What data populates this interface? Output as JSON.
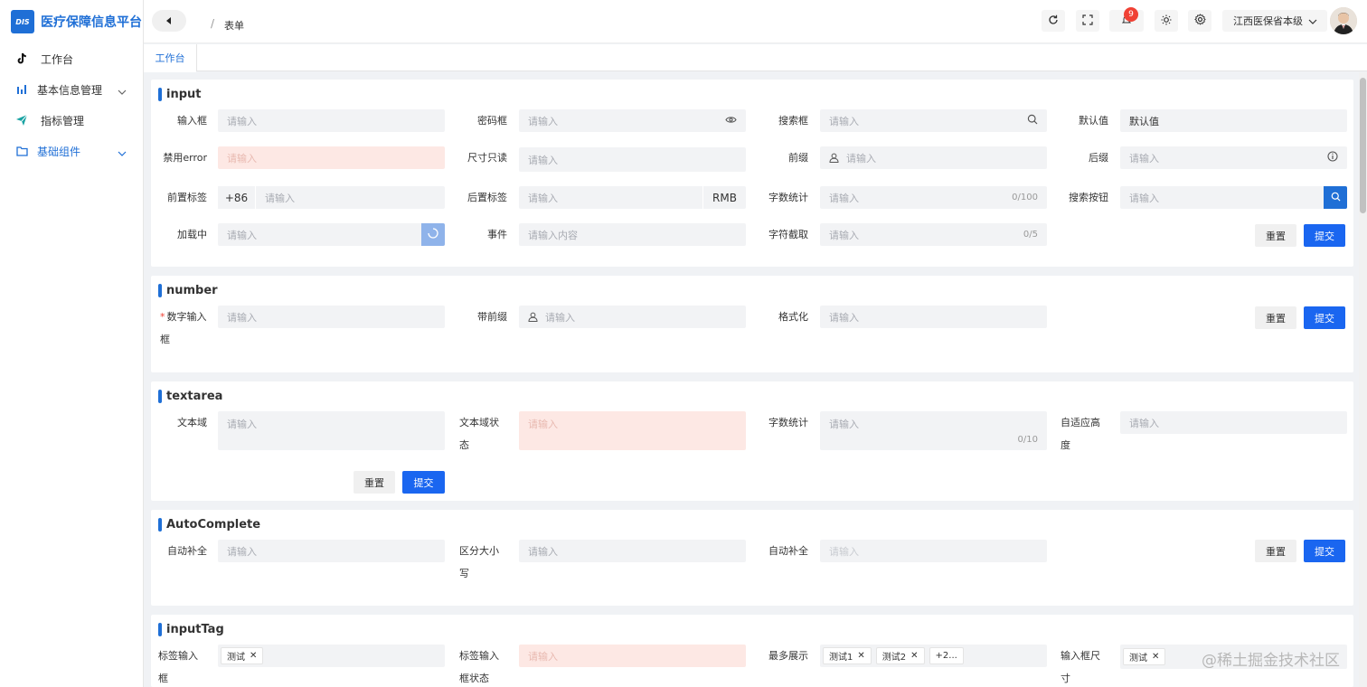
{
  "app": {
    "logo_mark": "DIS",
    "title": "医疗保障信息平台"
  },
  "sidebar": {
    "items": [
      {
        "label": "工作台",
        "icon": "tiktok-icon"
      },
      {
        "label": "基本信息管理",
        "icon": "bar-chart-icon"
      },
      {
        "label": "指标管理",
        "icon": "paper-plane-icon"
      },
      {
        "label": "基础组件",
        "icon": "folder-icon"
      }
    ]
  },
  "header": {
    "breadcrumb_sep": "/",
    "breadcrumb": "表单",
    "notification_count": "9",
    "org": "江西医保省本级"
  },
  "tabs": [
    {
      "label": "工作台"
    }
  ],
  "cards": {
    "input": {
      "title": "input",
      "labels": [
        "输入框",
        "密码框",
        "搜索框",
        "默认值",
        "禁用error",
        "尺寸只读",
        "前缀",
        "后缀",
        "前置标签",
        "后置标签",
        "字数统计",
        "搜索按钮",
        "加载中",
        "事件",
        "字符截取"
      ],
      "placeholder": "请输入",
      "event_placeholder": "请输入内容",
      "default_value": "默认值",
      "prepend": "+86",
      "append": "RMB",
      "count1": "0/100",
      "count2": "0/5"
    },
    "number": {
      "title": "number",
      "required_mark": "*",
      "labels": [
        "数字输入框",
        "带前缀",
        "格式化"
      ],
      "placeholder": "请输入"
    },
    "textarea": {
      "title": "textarea",
      "labels": [
        "文本域",
        "文本域状态",
        "字数统计",
        "自适应高度"
      ],
      "placeholder": "请输入",
      "count": "0/10"
    },
    "autocomplete": {
      "title": "AutoComplete",
      "labels": [
        "自动补全",
        "区分大小写",
        "自动补全"
      ],
      "placeholder": "请输入"
    },
    "inputtag": {
      "title": "inputTag",
      "labels": [
        "标签输入框",
        "标签输入框状态",
        "最多展示",
        "输入框尺寸"
      ],
      "placeholder": "请输入",
      "tags": {
        "t1": "测试",
        "t2": "测试1",
        "t3": "测试2",
        "more": "+2...",
        "t4": "测试"
      },
      "tag_close": "✕"
    }
  },
  "buttons": {
    "reset": "重置",
    "submit": "提交"
  },
  "watermark": "@稀土掘金技术社区"
}
